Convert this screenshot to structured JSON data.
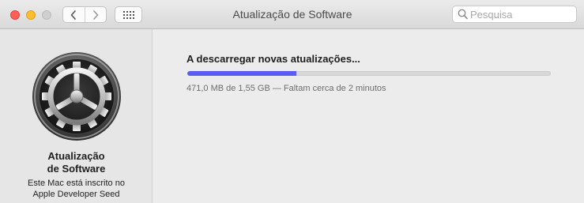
{
  "window": {
    "title": "Atualização de Software"
  },
  "toolbar": {
    "back_icon": "chevron-left-icon",
    "forward_icon": "chevron-right-icon",
    "grid_icon": "grid-icon"
  },
  "search": {
    "placeholder": "Pesquisa",
    "value": ""
  },
  "sidebar": {
    "icon": "gear-icon",
    "title_line1": "Atualização",
    "title_line2": "de Software",
    "desc_line1": "Este Mac está inscrito no",
    "desc_line2": "Apple Developer Seed"
  },
  "main": {
    "status_text": "A descarregar novas atualizações...",
    "progress": 0.3,
    "detail_text": "471,0 MB de 1,55 GB — Faltam cerca de 2 minutos",
    "progress_color": "#5b5cf0"
  }
}
